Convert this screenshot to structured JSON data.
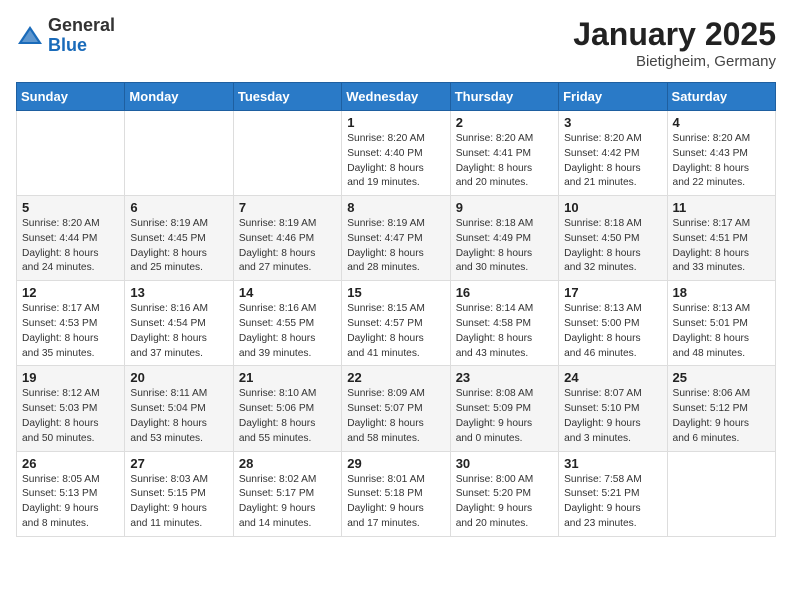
{
  "header": {
    "logo_general": "General",
    "logo_blue": "Blue",
    "month_title": "January 2025",
    "location": "Bietigheim, Germany"
  },
  "days_of_week": [
    "Sunday",
    "Monday",
    "Tuesday",
    "Wednesday",
    "Thursday",
    "Friday",
    "Saturday"
  ],
  "weeks": [
    [
      {
        "day": "",
        "info": ""
      },
      {
        "day": "",
        "info": ""
      },
      {
        "day": "",
        "info": ""
      },
      {
        "day": "1",
        "info": "Sunrise: 8:20 AM\nSunset: 4:40 PM\nDaylight: 8 hours\nand 19 minutes."
      },
      {
        "day": "2",
        "info": "Sunrise: 8:20 AM\nSunset: 4:41 PM\nDaylight: 8 hours\nand 20 minutes."
      },
      {
        "day": "3",
        "info": "Sunrise: 8:20 AM\nSunset: 4:42 PM\nDaylight: 8 hours\nand 21 minutes."
      },
      {
        "day": "4",
        "info": "Sunrise: 8:20 AM\nSunset: 4:43 PM\nDaylight: 8 hours\nand 22 minutes."
      }
    ],
    [
      {
        "day": "5",
        "info": "Sunrise: 8:20 AM\nSunset: 4:44 PM\nDaylight: 8 hours\nand 24 minutes."
      },
      {
        "day": "6",
        "info": "Sunrise: 8:19 AM\nSunset: 4:45 PM\nDaylight: 8 hours\nand 25 minutes."
      },
      {
        "day": "7",
        "info": "Sunrise: 8:19 AM\nSunset: 4:46 PM\nDaylight: 8 hours\nand 27 minutes."
      },
      {
        "day": "8",
        "info": "Sunrise: 8:19 AM\nSunset: 4:47 PM\nDaylight: 8 hours\nand 28 minutes."
      },
      {
        "day": "9",
        "info": "Sunrise: 8:18 AM\nSunset: 4:49 PM\nDaylight: 8 hours\nand 30 minutes."
      },
      {
        "day": "10",
        "info": "Sunrise: 8:18 AM\nSunset: 4:50 PM\nDaylight: 8 hours\nand 32 minutes."
      },
      {
        "day": "11",
        "info": "Sunrise: 8:17 AM\nSunset: 4:51 PM\nDaylight: 8 hours\nand 33 minutes."
      }
    ],
    [
      {
        "day": "12",
        "info": "Sunrise: 8:17 AM\nSunset: 4:53 PM\nDaylight: 8 hours\nand 35 minutes."
      },
      {
        "day": "13",
        "info": "Sunrise: 8:16 AM\nSunset: 4:54 PM\nDaylight: 8 hours\nand 37 minutes."
      },
      {
        "day": "14",
        "info": "Sunrise: 8:16 AM\nSunset: 4:55 PM\nDaylight: 8 hours\nand 39 minutes."
      },
      {
        "day": "15",
        "info": "Sunrise: 8:15 AM\nSunset: 4:57 PM\nDaylight: 8 hours\nand 41 minutes."
      },
      {
        "day": "16",
        "info": "Sunrise: 8:14 AM\nSunset: 4:58 PM\nDaylight: 8 hours\nand 43 minutes."
      },
      {
        "day": "17",
        "info": "Sunrise: 8:13 AM\nSunset: 5:00 PM\nDaylight: 8 hours\nand 46 minutes."
      },
      {
        "day": "18",
        "info": "Sunrise: 8:13 AM\nSunset: 5:01 PM\nDaylight: 8 hours\nand 48 minutes."
      }
    ],
    [
      {
        "day": "19",
        "info": "Sunrise: 8:12 AM\nSunset: 5:03 PM\nDaylight: 8 hours\nand 50 minutes."
      },
      {
        "day": "20",
        "info": "Sunrise: 8:11 AM\nSunset: 5:04 PM\nDaylight: 8 hours\nand 53 minutes."
      },
      {
        "day": "21",
        "info": "Sunrise: 8:10 AM\nSunset: 5:06 PM\nDaylight: 8 hours\nand 55 minutes."
      },
      {
        "day": "22",
        "info": "Sunrise: 8:09 AM\nSunset: 5:07 PM\nDaylight: 8 hours\nand 58 minutes."
      },
      {
        "day": "23",
        "info": "Sunrise: 8:08 AM\nSunset: 5:09 PM\nDaylight: 9 hours\nand 0 minutes."
      },
      {
        "day": "24",
        "info": "Sunrise: 8:07 AM\nSunset: 5:10 PM\nDaylight: 9 hours\nand 3 minutes."
      },
      {
        "day": "25",
        "info": "Sunrise: 8:06 AM\nSunset: 5:12 PM\nDaylight: 9 hours\nand 6 minutes."
      }
    ],
    [
      {
        "day": "26",
        "info": "Sunrise: 8:05 AM\nSunset: 5:13 PM\nDaylight: 9 hours\nand 8 minutes."
      },
      {
        "day": "27",
        "info": "Sunrise: 8:03 AM\nSunset: 5:15 PM\nDaylight: 9 hours\nand 11 minutes."
      },
      {
        "day": "28",
        "info": "Sunrise: 8:02 AM\nSunset: 5:17 PM\nDaylight: 9 hours\nand 14 minutes."
      },
      {
        "day": "29",
        "info": "Sunrise: 8:01 AM\nSunset: 5:18 PM\nDaylight: 9 hours\nand 17 minutes."
      },
      {
        "day": "30",
        "info": "Sunrise: 8:00 AM\nSunset: 5:20 PM\nDaylight: 9 hours\nand 20 minutes."
      },
      {
        "day": "31",
        "info": "Sunrise: 7:58 AM\nSunset: 5:21 PM\nDaylight: 9 hours\nand 23 minutes."
      },
      {
        "day": "",
        "info": ""
      }
    ]
  ]
}
